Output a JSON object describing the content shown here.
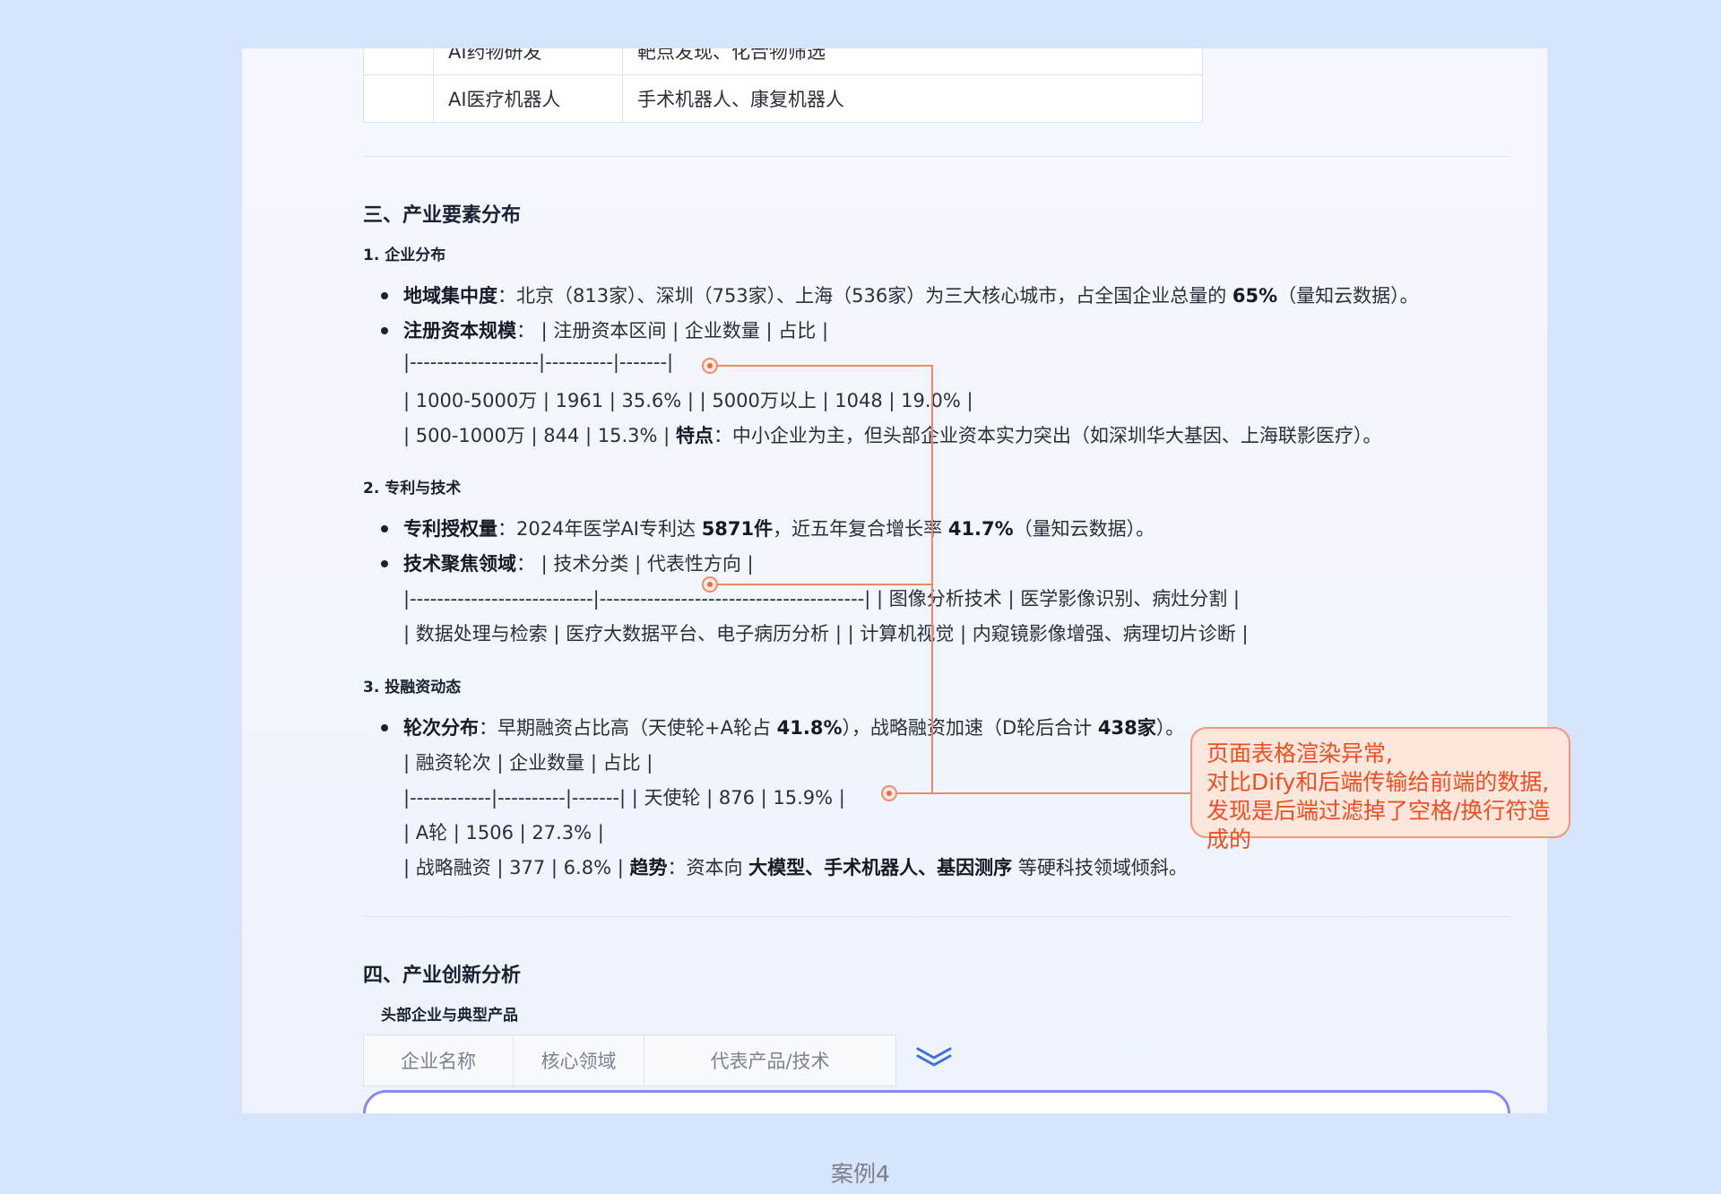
{
  "top_table": {
    "rows": [
      {
        "c1": "AI药物研发",
        "c2": "靶点发现、化合物筛选"
      },
      {
        "c1": "AI医疗机器人",
        "c2": "手术机器人、康复机器人"
      }
    ]
  },
  "section3": {
    "title": "三、产业要素分布",
    "sub1": {
      "title": "1. 企业分布",
      "b1_label": "地域集中度",
      "b1_text": "：北京（813家）、深圳（753家）、上海（536家）为三大核心城市，占全国企业总量的 ",
      "b1_bold": "65%",
      "b1_tail": "（量知云数据）。",
      "b2_label": "注册资本规模",
      "b2_text": "： | 注册资本区间 | 企业数量 | 占比 |",
      "l3": "|-------------------|----------|-------|",
      "l4": "| 1000-5000万 | 1961 | 35.6% | | 5000万以上 | 1048 | 19.0% |",
      "l5_pre": "| 500-1000万 | 844 | 15.3% | ",
      "l5_bold": "特点",
      "l5_tail": "：中小企业为主，但头部企业资本实力突出（如深圳华大基因、上海联影医疗）。"
    },
    "sub2": {
      "title": "2. 专利与技术",
      "b1_label": "专利授权量",
      "b1_text": "：2024年医学AI专利达 ",
      "b1_bold1": "5871件",
      "b1_mid": "，近五年复合增长率 ",
      "b1_bold2": "41.7%",
      "b1_tail": "（量知云数据）。",
      "b2_label": "技术聚焦领域",
      "b2_text": "： | 技术分类 | 代表性方向 |",
      "l3": "|---------------------------|---------------------------------------| | 图像分析技术 | 医学影像识别、病灶分割 |",
      "l4": "| 数据处理与检索 | 医疗大数据平台、电子病历分析 | | 计算机视觉 | 内窥镜影像增强、病理切片诊断 |"
    },
    "sub3": {
      "title": "3. 投融资动态",
      "b1_label": "轮次分布",
      "b1_text": "：早期融资占比高（天使轮+A轮占 ",
      "b1_bold1": "41.8%",
      "b1_mid": "），战略融资加速（D轮后合计 ",
      "b1_bold2": "438家",
      "b1_tail": "）。",
      "l2": "| 融资轮次 | 企业数量 | 占比 |",
      "l3": "|------------|----------|-------| | 天使轮 | 876 | 15.9% |",
      "l4": "| A轮 | 1506 | 27.3% |",
      "l5_pre": "| 战略融资 | 377 | 6.8% | ",
      "l5_bold1": "趋势",
      "l5_mid": "：资本向 ",
      "l5_bold2": "大模型、手术机器人、基因测序",
      "l5_tail": " 等硬科技领域倾斜。"
    }
  },
  "section4": {
    "title": "四、产业创新分析",
    "subtitle": "头部企业与典型产品",
    "headers": [
      "企业名称",
      "核心领域",
      "代表产品/技术"
    ]
  },
  "callout": {
    "line1": "页面表格渲染异常,",
    "line2": "对比Dify和后端传输给前端的数据,",
    "line3": "发现是后端过滤掉了空格/换行符造成的"
  },
  "caption": "案例4"
}
